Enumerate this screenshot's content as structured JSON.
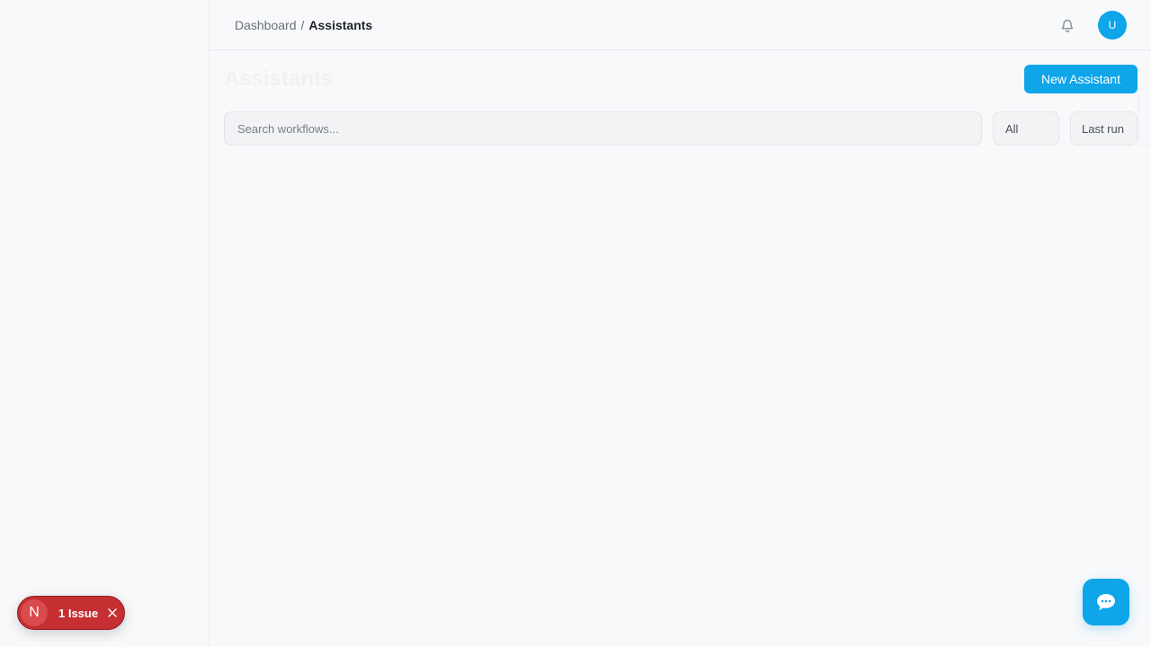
{
  "breadcrumb": {
    "parent": "Dashboard",
    "separator": "/",
    "current": "Assistants"
  },
  "header": {
    "avatar_initial": "U"
  },
  "page": {
    "title": "Assistants",
    "new_button_label": "New Assistant"
  },
  "search": {
    "placeholder": "Search workflows...",
    "value": ""
  },
  "filters": {
    "status": "All",
    "sort": "Last run"
  },
  "issues_badge": {
    "logo_letter": "N",
    "label": "1 Issue"
  },
  "icons": {
    "notifications": "bell-icon",
    "close": "close-icon",
    "chat": "chat-bubble-icon"
  },
  "colors": {
    "accent": "#0ea5e9",
    "issue": "#c62f32",
    "background": "#f8f9fb"
  }
}
